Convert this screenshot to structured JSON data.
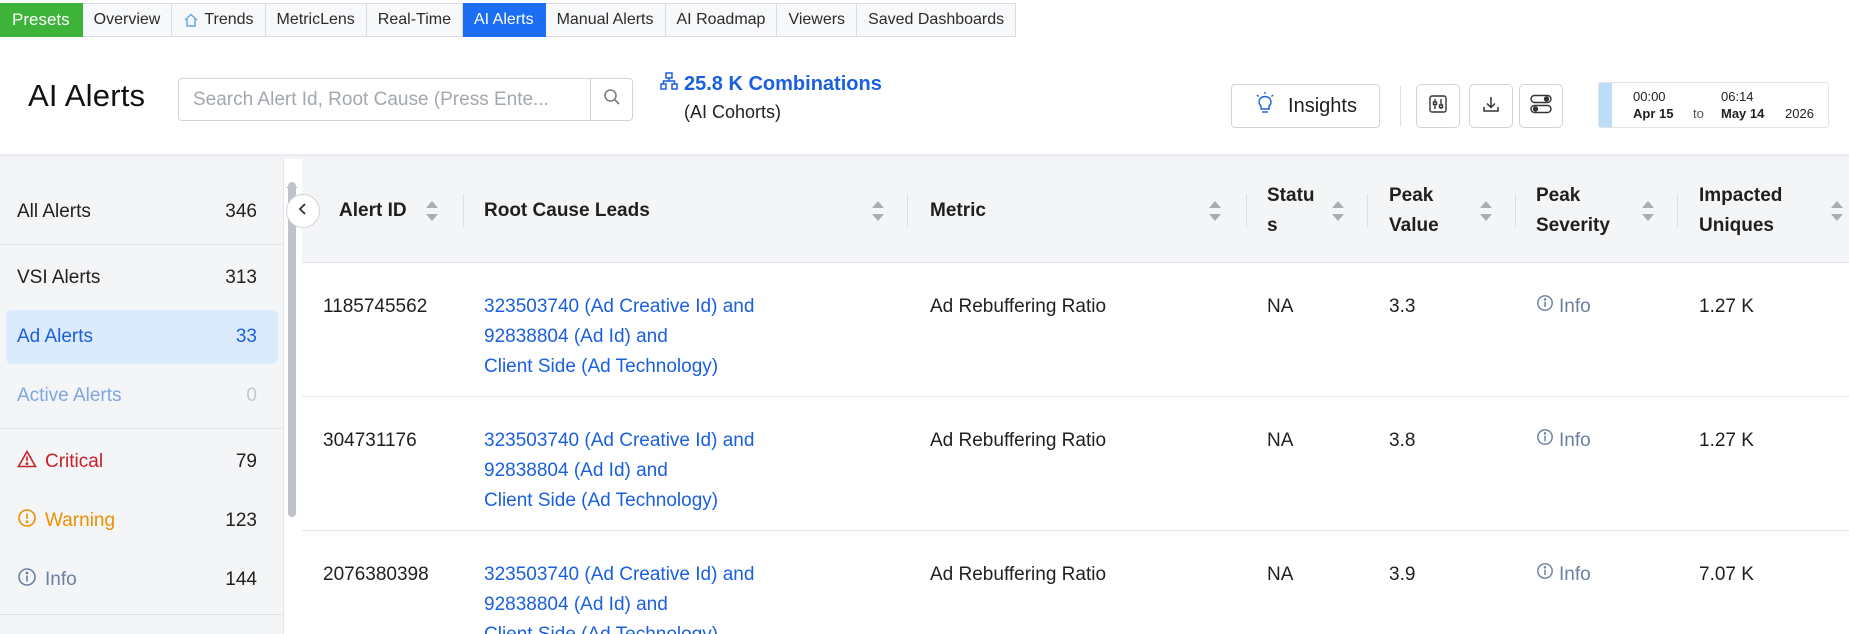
{
  "tabs": {
    "presets": "Presets",
    "items": [
      {
        "label": "Overview",
        "icon": ""
      },
      {
        "label": "Trends",
        "icon": "home-icon"
      },
      {
        "label": "MetricLens",
        "icon": ""
      },
      {
        "label": "Real-Time",
        "icon": ""
      },
      {
        "label": "AI Alerts",
        "icon": "",
        "active": true
      },
      {
        "label": "Manual Alerts",
        "icon": ""
      },
      {
        "label": "AI Roadmap",
        "icon": ""
      },
      {
        "label": "Viewers",
        "icon": ""
      },
      {
        "label": "Saved Dashboards",
        "icon": ""
      }
    ]
  },
  "header": {
    "title": "AI Alerts",
    "search_placeholder": "Search Alert Id, Root Cause (Press Ente...",
    "combinations_label": "25.8 K Combinations",
    "combinations_sub": "(AI Cohorts)",
    "insights_label": "Insights",
    "date_range": {
      "start_time": "00:00",
      "end_time": "06:14",
      "start_date": "Apr 15",
      "to": "to",
      "end_date": "May 14",
      "year": "2026"
    }
  },
  "sidebar": {
    "items": [
      {
        "label": "All Alerts",
        "count": "346"
      },
      {
        "label": "VSI Alerts",
        "count": "313"
      },
      {
        "label": "Ad Alerts",
        "count": "33"
      },
      {
        "label": "Active Alerts",
        "count": "0"
      },
      {
        "label": "Critical",
        "count": "79",
        "icon": "warning-triangle-icon"
      },
      {
        "label": "Warning",
        "count": "123",
        "icon": "exclamation-circle-icon"
      },
      {
        "label": "Info",
        "count": "144",
        "icon": "info-circle-icon"
      }
    ]
  },
  "table": {
    "columns": [
      "Alert ID",
      "Root Cause Leads",
      "Metric",
      "Statu\ns",
      "Peak\nValue",
      "Peak\nSeverity",
      "Impacted\nUniques"
    ],
    "rows": [
      {
        "alert_id": "1185745562",
        "root_cause": [
          "323503740 (Ad Creative Id) and",
          "92838804 (Ad Id) and",
          "Client Side (Ad Technology)"
        ],
        "metric": "Ad Rebuffering Ratio",
        "status": "NA",
        "peak_value": "3.3",
        "peak_severity": "Info",
        "impacted_uniques": "1.27 K"
      },
      {
        "alert_id": "304731176",
        "root_cause": [
          "323503740 (Ad Creative Id) and",
          "92838804 (Ad Id) and",
          "Client Side (Ad Technology)"
        ],
        "metric": "Ad Rebuffering Ratio",
        "status": "NA",
        "peak_value": "3.8",
        "peak_severity": "Info",
        "impacted_uniques": "1.27 K"
      },
      {
        "alert_id": "2076380398",
        "root_cause": [
          "323503740 (Ad Creative Id) and",
          "92838804 (Ad Id) and",
          "Client Side (Ad Technology)"
        ],
        "metric": "Ad Rebuffering Ratio",
        "status": "NA",
        "peak_value": "3.9",
        "peak_severity": "Info",
        "impacted_uniques": "7.07 K"
      }
    ]
  },
  "colors": {
    "presets_green": "#3db33a",
    "active_blue": "#1b6ef3",
    "link_blue": "#1a5fe0",
    "critical_red": "#c8202a",
    "warning_orange": "#ef8f00",
    "info_slate": "#6b7fa3"
  }
}
